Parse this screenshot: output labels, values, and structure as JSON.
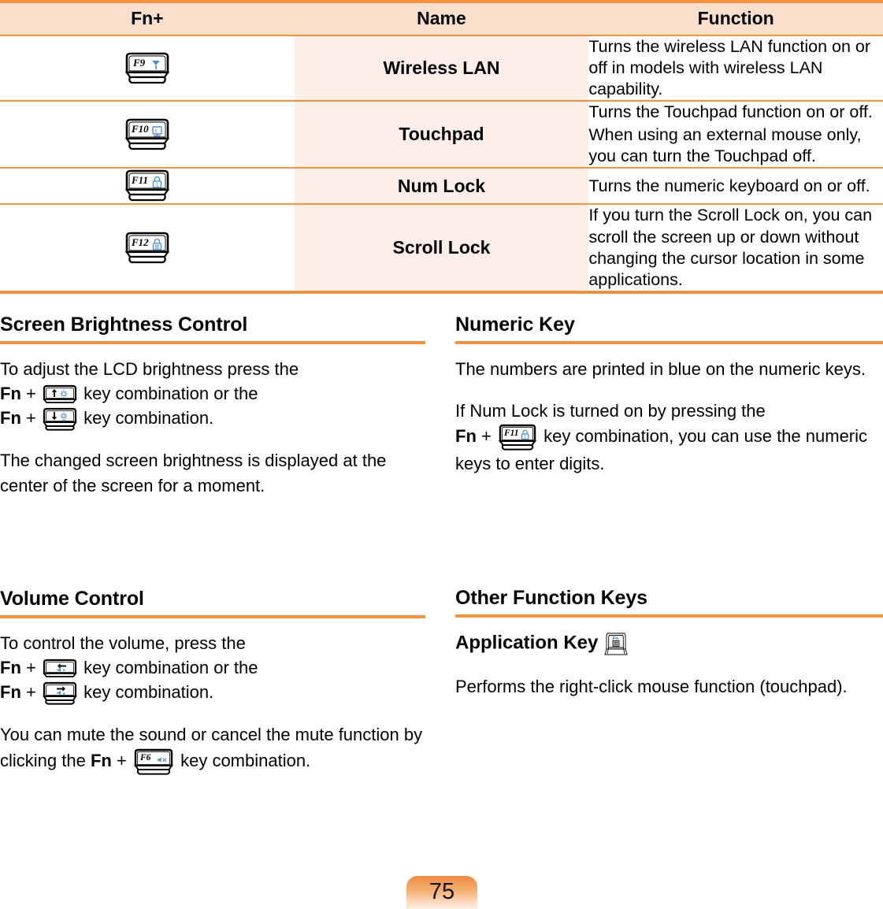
{
  "colors": {
    "rule_orange": "#F3923F",
    "header_bg": "#FBDFCD",
    "name_col_bg": "#FDEFE7",
    "key_legend_blue": "#4A8FD4",
    "text": "#000000"
  },
  "table": {
    "name": "fn-key-function-table",
    "headers": {
      "fn": "Fn+",
      "name": "Name",
      "function": "Function"
    },
    "rows": [
      {
        "key_label": "F9",
        "key_icon": "wireless-antenna-icon",
        "name": "Wireless LAN",
        "function_lines": [
          "Turns the wireless LAN function on or off in models with wireless LAN capability."
        ]
      },
      {
        "key_label": "F10",
        "key_icon": "touchpad-icon",
        "name": "Touchpad",
        "function_lines": [
          "Turns the Touchpad function on or off.",
          "When using an external mouse only, you can turn the Touchpad off."
        ]
      },
      {
        "key_label": "F11",
        "key_icon": "numlock-padlock-icon",
        "name": "Num Lock",
        "function_lines": [
          "Turns the numeric keyboard on or off."
        ]
      },
      {
        "key_label": "F12",
        "key_icon": "scrolllock-padlock-icon",
        "name": "Scroll Lock",
        "function_lines": [
          "If you turn the Scroll Lock on, you can scroll the screen up or down without changing the cursor location in some applications."
        ]
      }
    ]
  },
  "sections": {
    "screen_brightness": {
      "title": "Screen Brightness Control",
      "para1": {
        "t1": "To adjust the LCD brightness press the",
        "fn1": "Fn",
        "plus1": "+",
        "key1_icon": "brightness-up-arrow-key",
        "t2": "key combination or the",
        "fn2": "Fn",
        "plus2": "+",
        "key2_icon": "brightness-down-arrow-key",
        "t3": "key combination."
      },
      "para2": "The changed screen brightness is displayed at the center of the screen for a moment."
    },
    "numeric_key": {
      "title": "Numeric Key",
      "para1": "The numbers are printed in blue on the numeric keys.",
      "para2": {
        "t1": "If Num Lock is turned on by pressing the",
        "fn1": "Fn",
        "plus1": "+",
        "key1_label": "F11",
        "key1_icon": "numlock-padlock-icon",
        "t2": "key combination, you can use the numeric keys to enter digits."
      }
    },
    "volume_control": {
      "title": "Volume Control",
      "para1": {
        "t1": "To control the volume, press the",
        "fn1": "Fn",
        "plus1": "+",
        "key1_icon": "volume-down-left-arrow-key",
        "t2": "key combination or the",
        "fn2": "Fn",
        "plus2": "+",
        "key2_icon": "volume-up-right-arrow-key",
        "t3": "key combination."
      },
      "para2": {
        "t1": "You can mute the sound or cancel the mute function by clicking the",
        "fn1": "Fn",
        "plus1": "+",
        "key1_label": "F6",
        "key1_icon": "mute-speaker-icon",
        "t2": "key combination."
      }
    },
    "other_function_keys": {
      "title": "Other Function Keys",
      "subhead": "Application Key",
      "subhead_key_icon": "application-key-fn",
      "subhead_key_label": "Fn",
      "para1": "Performs the right-click mouse function (touchpad)."
    }
  },
  "page_number": "75"
}
